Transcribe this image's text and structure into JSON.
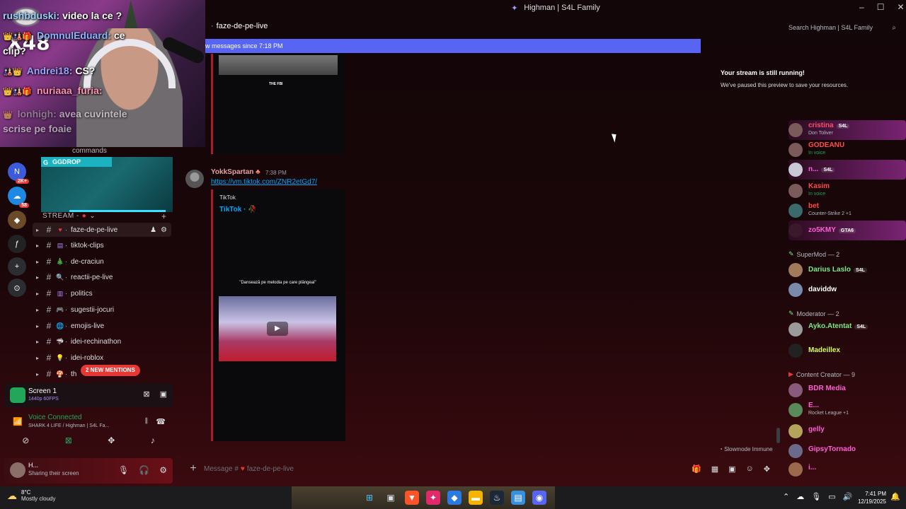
{
  "window": {
    "title": "Highman | S4L Family"
  },
  "webcam": {
    "multiplier": "X48"
  },
  "header": {
    "channel": "faze-de-pe-live",
    "search_placeholder": "Search Highman | S4L Family"
  },
  "new_messages_bar": "w messages since 7:18 PM",
  "sidebar": {
    "commands_label": "commands",
    "ggdrop_label": "GGDROP",
    "category": "STREAM -",
    "channels": [
      {
        "name": "faze-de-pe-live",
        "emoji": "♥",
        "active": true
      },
      {
        "name": "tiktok-clips",
        "emoji": "▤"
      },
      {
        "name": "de-craciun",
        "emoji": "🎄"
      },
      {
        "name": "reactii-pe-live",
        "emoji": "🔍"
      },
      {
        "name": "politics",
        "emoji": "▥"
      },
      {
        "name": "sugestii-jocuri",
        "emoji": "🎮"
      },
      {
        "name": "emojis-live",
        "emoji": "🌐"
      },
      {
        "name": "idei-rechinathon",
        "emoji": "🦈"
      },
      {
        "name": "idei-roblox",
        "emoji": "💡"
      },
      {
        "name": "th",
        "emoji": "🍄"
      }
    ],
    "mentions_pill": "2 NEW MENTIONS",
    "server_badges": {
      "b1": "2K+",
      "b2": "58"
    }
  },
  "screen_share": {
    "title": "Screen 1",
    "quality": "1440p 60FPS"
  },
  "voice": {
    "status": "Voice Connected",
    "channel": "SHARK 4 LIFE / Highman | S4L Fa..."
  },
  "user": {
    "name": "H...",
    "status": "Sharing their screen"
  },
  "messages": {
    "top_embed_caption": "THE FBI",
    "author": "YokkSpartan",
    "time": "7:38 PM",
    "link": "https://vm.tiktok.com/ZNR2etGd7/",
    "embed_provider": "TikTok",
    "embed_title": "TikTok · 🥀",
    "video_caption": "\"Dansează pe melodia pe care plângeai\""
  },
  "slowmode": "Slowmode Immune",
  "composer": {
    "placeholder": "Message #",
    "channel": "faze-de-pe-live"
  },
  "stream_chat": [
    {
      "user": "rushbduski:",
      "text": "video la ce ?",
      "color": "#9ad0ff"
    },
    {
      "user": "DomnulEduard:",
      "text": "ce",
      "color": "#8ab4ff"
    },
    {
      "user": "",
      "text": "clip?",
      "color": "#ffffff"
    },
    {
      "user": "Andrei18:",
      "text": "CS?",
      "color": "#9aa3ff"
    },
    {
      "user": "nuriaaa_furia:",
      "text": "",
      "color": "#ff8fb1"
    },
    {
      "user": "lonhigh:",
      "text": "avea cuvintele",
      "color": "#b3b3b3"
    },
    {
      "user": "",
      "text": "scrise pe foaie",
      "color": "#b3b3b3"
    }
  ],
  "stream_notice": {
    "line1": "Your stream is still running!",
    "line2": "We've paused this preview to save your resources."
  },
  "members": {
    "top": [
      {
        "name": "cristina",
        "tag": "S4L",
        "sub": "Don Toliver",
        "color": "#ff4d6d"
      },
      {
        "name": "GODEANU",
        "sub": "In voice",
        "color": "#ff4d4d"
      },
      {
        "name": "n...",
        "tag": "S4L",
        "sub": "",
        "color": "#ff5fd7"
      },
      {
        "name": "Kasim",
        "sub": "In voice",
        "color": "#ff4d4d"
      },
      {
        "name": "bet",
        "sub": "Counter-Strike 2 +1",
        "color": "#ff4d4d"
      },
      {
        "name": "zo5KMY",
        "tag": "GTA6",
        "sub": "",
        "color": "#ff5fd7"
      }
    ],
    "group_supermod": "SuperMod — 2",
    "supermods": [
      {
        "name": "Darius Laslo",
        "tag": "S4L",
        "color": "#7ee787"
      },
      {
        "name": "daviddw",
        "color": "#ffffff"
      }
    ],
    "group_moderator": "Moderator — 2",
    "moderators": [
      {
        "name": "Ayko.Atentat",
        "tag": "S4L",
        "color": "#7ee787"
      },
      {
        "name": "Madeillex",
        "color": "#d4ff5a"
      }
    ],
    "group_creator": "Content Creator — 9",
    "creators": [
      {
        "name": "BDR Media",
        "sub": "",
        "color": "#ff5fd7"
      },
      {
        "name": "E...",
        "sub": "Rocket League +1",
        "color": "#ff5fd7"
      },
      {
        "name": "gelly",
        "sub": "",
        "color": "#ff5fd7"
      },
      {
        "name": "GipsyTornado",
        "sub": "",
        "color": "#ff5fd7"
      },
      {
        "name": "i...",
        "sub": "",
        "color": "#ff5fd7"
      }
    ]
  },
  "taskbar": {
    "temp": "8°C",
    "weather": "Mostly cloudy",
    "time": "7:41 PM",
    "date": "12/19/2025"
  }
}
